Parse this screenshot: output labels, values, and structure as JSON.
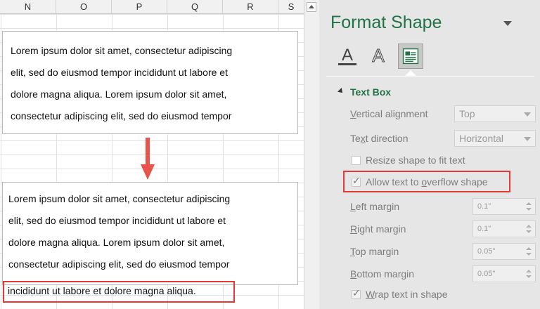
{
  "sheet": {
    "columns": [
      "N",
      "O",
      "P",
      "Q",
      "R",
      "S"
    ]
  },
  "textbox1": {
    "lines": [
      "Lorem ipsum dolor sit amet, consectetur adipiscing",
      "elit, sed do eiusmod tempor incididunt ut labore et",
      "dolore magna aliqua. Lorem ipsum dolor sit amet,",
      "consectetur adipiscing elit, sed do eiusmod tempor"
    ]
  },
  "textbox2": {
    "lines": [
      "Lorem ipsum dolor sit amet, consectetur adipiscing",
      "elit, sed do eiusmod tempor incididunt ut labore et",
      "dolore magna aliqua. Lorem ipsum dolor sit amet,",
      "consectetur adipiscing elit, sed do eiusmod tempor"
    ],
    "overflow_line": "incididunt ut labore et dolore magna aliqua."
  },
  "pane": {
    "title": "Format Shape",
    "tabs": [
      {
        "name": "Text Fill & Outline",
        "icon": "text-fill-outline-icon"
      },
      {
        "name": "Text Effects",
        "icon": "text-effects-icon"
      },
      {
        "name": "Text Box",
        "icon": "textbox-icon"
      }
    ],
    "section": {
      "title": "Text Box",
      "vertical_alignment": {
        "label": "Vertical alignment",
        "value": "Top"
      },
      "text_direction": {
        "label": "Text direction",
        "value": "Horizontal"
      },
      "resize_shape": {
        "label": "Resize shape to fit text",
        "checked": false
      },
      "allow_overflow": {
        "label": "Allow text to overflow shape",
        "checked": true
      },
      "left_margin": {
        "label": "Left margin",
        "value": "0.1\""
      },
      "right_margin": {
        "label": "Right margin",
        "value": "0.1\""
      },
      "top_margin": {
        "label": "Top margin",
        "value": "0.05\""
      },
      "bottom_margin": {
        "label": "Bottom margin",
        "value": "0.05\""
      },
      "wrap_text": {
        "label": "Wrap text in shape",
        "checked": true
      }
    }
  },
  "colors": {
    "accent": "#217346",
    "highlight": "#e53935",
    "arrow": "#e8534a"
  }
}
